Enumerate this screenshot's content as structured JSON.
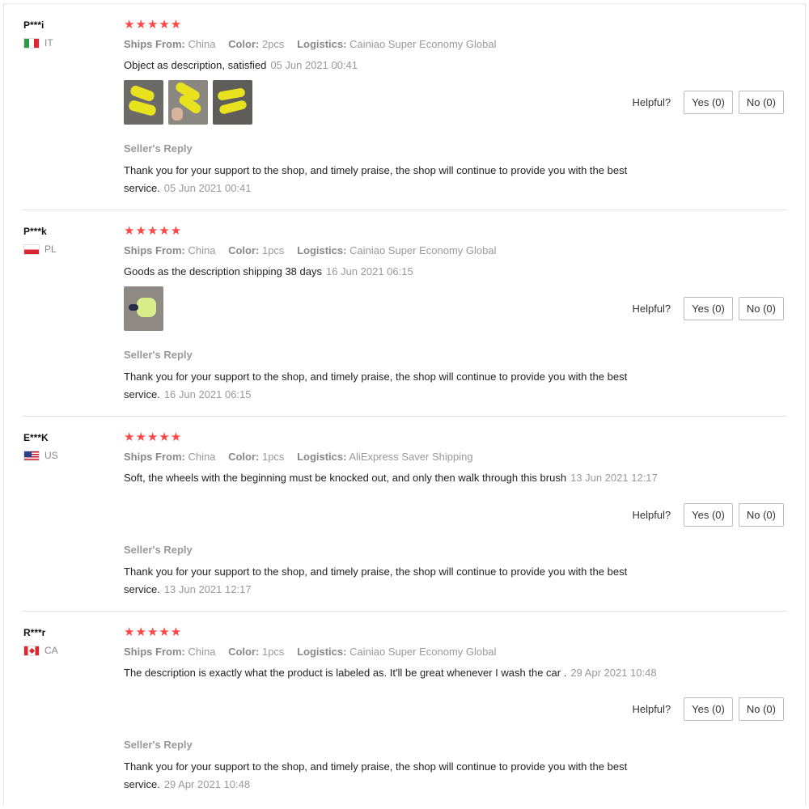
{
  "reviews": [
    {
      "user": "P***i",
      "country": "IT",
      "rating": "★★★★★",
      "ships_label": "Ships From:",
      "ships_value": "China",
      "color_label": "Color:",
      "color_value": "2pcs",
      "logistics_label": "Logistics:",
      "logistics_value": "Cainiao Super Economy Global",
      "text": "Object as description, satisfied",
      "date": "05 Jun 2021 00:41",
      "helpful_label": "Helpful?",
      "yes_label": "Yes (0)",
      "no_label": "No (0)",
      "reply_title": "Seller's Reply",
      "reply_text": "Thank you for your support to the shop, and timely praise, the shop will continue to provide you with the best service.",
      "reply_date": "05 Jun 2021 00:41"
    },
    {
      "user": "P***k",
      "country": "PL",
      "rating": "★★★★★",
      "ships_label": "Ships From:",
      "ships_value": "China",
      "color_label": "Color:",
      "color_value": "1pcs",
      "logistics_label": "Logistics:",
      "logistics_value": "Cainiao Super Economy Global",
      "text": "Goods as the description shipping 38 days",
      "date": "16 Jun 2021 06:15",
      "helpful_label": "Helpful?",
      "yes_label": "Yes (0)",
      "no_label": "No (0)",
      "reply_title": "Seller's Reply",
      "reply_text": "Thank you for your support to the shop, and timely praise, the shop will continue to provide you with the best service.",
      "reply_date": "16 Jun 2021 06:15"
    },
    {
      "user": "E***K",
      "country": "US",
      "rating": "★★★★★",
      "ships_label": "Ships From:",
      "ships_value": "China",
      "color_label": "Color:",
      "color_value": "1pcs",
      "logistics_label": "Logistics:",
      "logistics_value": "AliExpress Saver Shipping",
      "text": "Soft, the wheels with the beginning must be knocked out, and only then walk through this brush",
      "date": "13 Jun 2021 12:17",
      "helpful_label": "Helpful?",
      "yes_label": "Yes (0)",
      "no_label": "No (0)",
      "reply_title": "Seller's Reply",
      "reply_text": "Thank you for your support to the shop, and timely praise, the shop will continue to provide you with the best service.",
      "reply_date": "13 Jun 2021 12:17"
    },
    {
      "user": "R***r",
      "country": "CA",
      "rating": "★★★★★",
      "ships_label": "Ships From:",
      "ships_value": "China",
      "color_label": "Color:",
      "color_value": "1pcs",
      "logistics_label": "Logistics:",
      "logistics_value": "Cainiao Super Economy Global",
      "text": "The description is exactly what the product is labeled as. It'll be great whenever I wash the car .",
      "date": "29 Apr 2021 10:48",
      "helpful_label": "Helpful?",
      "yes_label": "Yes (0)",
      "no_label": "No (0)",
      "reply_title": "Seller's Reply",
      "reply_text": "Thank you for your support to the shop, and timely praise, the shop will continue to provide you with the best service.",
      "reply_date": "29 Apr 2021 10:48"
    }
  ],
  "colors": {
    "star": "#ff4747",
    "muted": "#999999",
    "divider": "#e2e2e2"
  },
  "icons": {
    "flag_it": "italy-flag-icon",
    "flag_pl": "poland-flag-icon",
    "flag_us": "usa-flag-icon",
    "flag_ca": "canada-flag-icon"
  }
}
